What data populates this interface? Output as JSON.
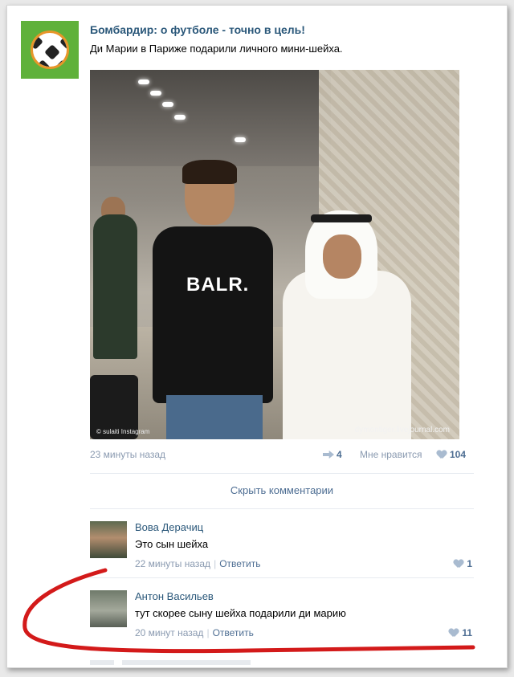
{
  "post": {
    "group_name": "Бомбардир: о футболе - точно в цель!",
    "text": "Ди Марии в Париже подарили личного мини-шейха.",
    "photo": {
      "shirt_text": "BALR.",
      "watermark_left": "© sulaiti Instagram",
      "watermark_right": "dymontiger.livejournal.com"
    },
    "time": "23 минуты назад",
    "shares": "4",
    "like_label": "Мне нравится",
    "likes": "104",
    "hide_comments": "Скрыть комментарии"
  },
  "comments": [
    {
      "author": "Вова Дерачиц",
      "text": "Это сын шейха",
      "time": "22 минуты назад",
      "reply": "Ответить",
      "likes": "1"
    },
    {
      "author": "Антон Васильев",
      "text": "тут скорее сыну шейха подарили ди марию",
      "time": "20 минут назад",
      "reply": "Ответить",
      "likes": "11"
    }
  ],
  "colors": {
    "link": "#2b587a",
    "meta": "#8a9ab0",
    "accent": "#4e6e93",
    "highlight": "#d31a1a"
  }
}
